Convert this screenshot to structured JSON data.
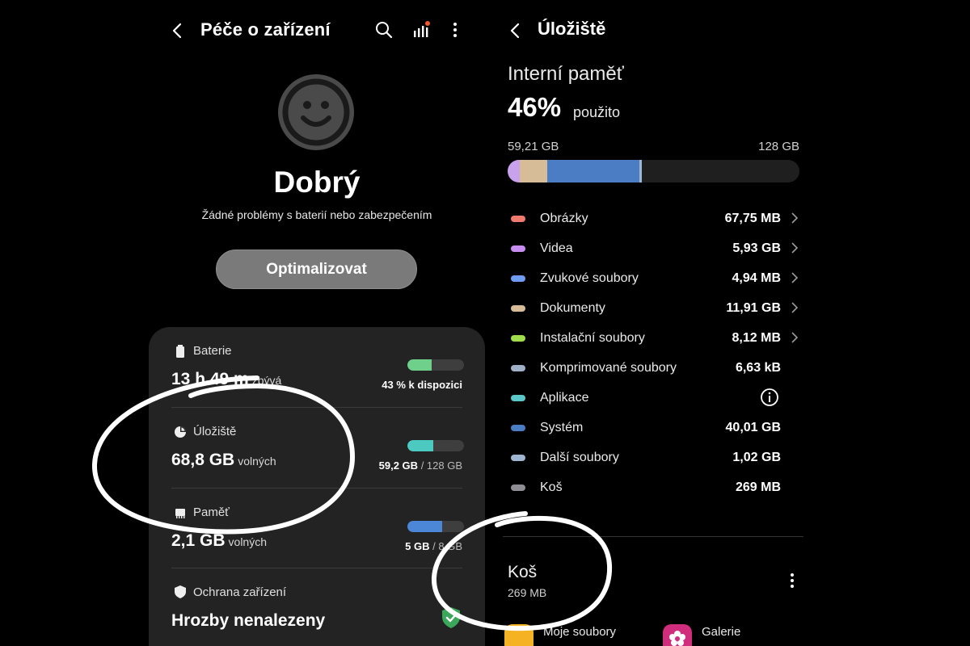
{
  "left": {
    "title": "Péče o zařízení",
    "status": {
      "title": "Dobrý",
      "subtitle": "Žádné problémy s baterií nebo zabezpečením"
    },
    "optimize_label": "Optimalizovat",
    "card": {
      "battery": {
        "label": "Baterie",
        "value": "13 h 49 m",
        "unit": "zbývá",
        "caption": "43 % k dispozici",
        "fill": 0.43,
        "color": "#6fd08b"
      },
      "storage": {
        "label": "Úložiště",
        "value": "68,8 GB",
        "unit": "volných",
        "caption_used": "59,2 GB",
        "caption_total": "/ 128 GB",
        "fill": 0.46,
        "color": "#4cc9c0"
      },
      "memory": {
        "label": "Paměť",
        "value": "2,1 GB",
        "unit": "volných",
        "caption_used": "5 GB",
        "caption_total": "/ 8 GB",
        "fill": 0.62,
        "color": "#4b87d6"
      },
      "protection": {
        "label": "Ochrana zařízení",
        "value": "Hrozby nenalezeny"
      }
    }
  },
  "right": {
    "title": "Úložiště",
    "internal_title": "Interní paměť",
    "percent": "46%",
    "percent_sub": "použito",
    "used": "59,21 GB",
    "total": "128 GB",
    "categories": [
      {
        "name": "Obrázky",
        "size": "67,75 MB",
        "color": "#f07a6e",
        "chevron": true
      },
      {
        "name": "Videa",
        "size": "5,93 GB",
        "color": "#c78cf0",
        "chevron": true
      },
      {
        "name": "Zvukové soubory",
        "size": "4,94 MB",
        "color": "#6d9cf2",
        "chevron": true
      },
      {
        "name": "Dokumenty",
        "size": "11,91 GB",
        "color": "#d6bd97",
        "chevron": true
      },
      {
        "name": "Instalační soubory",
        "size": "8,12 MB",
        "color": "#9fdc4e",
        "chevron": true
      },
      {
        "name": "Komprimované soubory",
        "size": "6,63 kB",
        "color": "#9fb0c8",
        "chevron": false
      },
      {
        "name": "Aplikace",
        "size": "",
        "color": "#5bc7c9",
        "chevron": false,
        "info": true
      },
      {
        "name": "Systém",
        "size": "40,01 GB",
        "color": "#4a7dc4",
        "chevron": false
      },
      {
        "name": "Další soubory",
        "size": "1,02 GB",
        "color": "#9fb6d0",
        "chevron": false
      },
      {
        "name": "Koš",
        "size": "269 MB",
        "color": "#8e8e94",
        "chevron": false
      }
    ],
    "trash": {
      "title": "Koš",
      "size": "269 MB"
    },
    "apps": [
      {
        "name": "Moje soubory",
        "color": "#f5b323"
      },
      {
        "name": "Galerie",
        "color": "#d02e7d"
      }
    ]
  }
}
